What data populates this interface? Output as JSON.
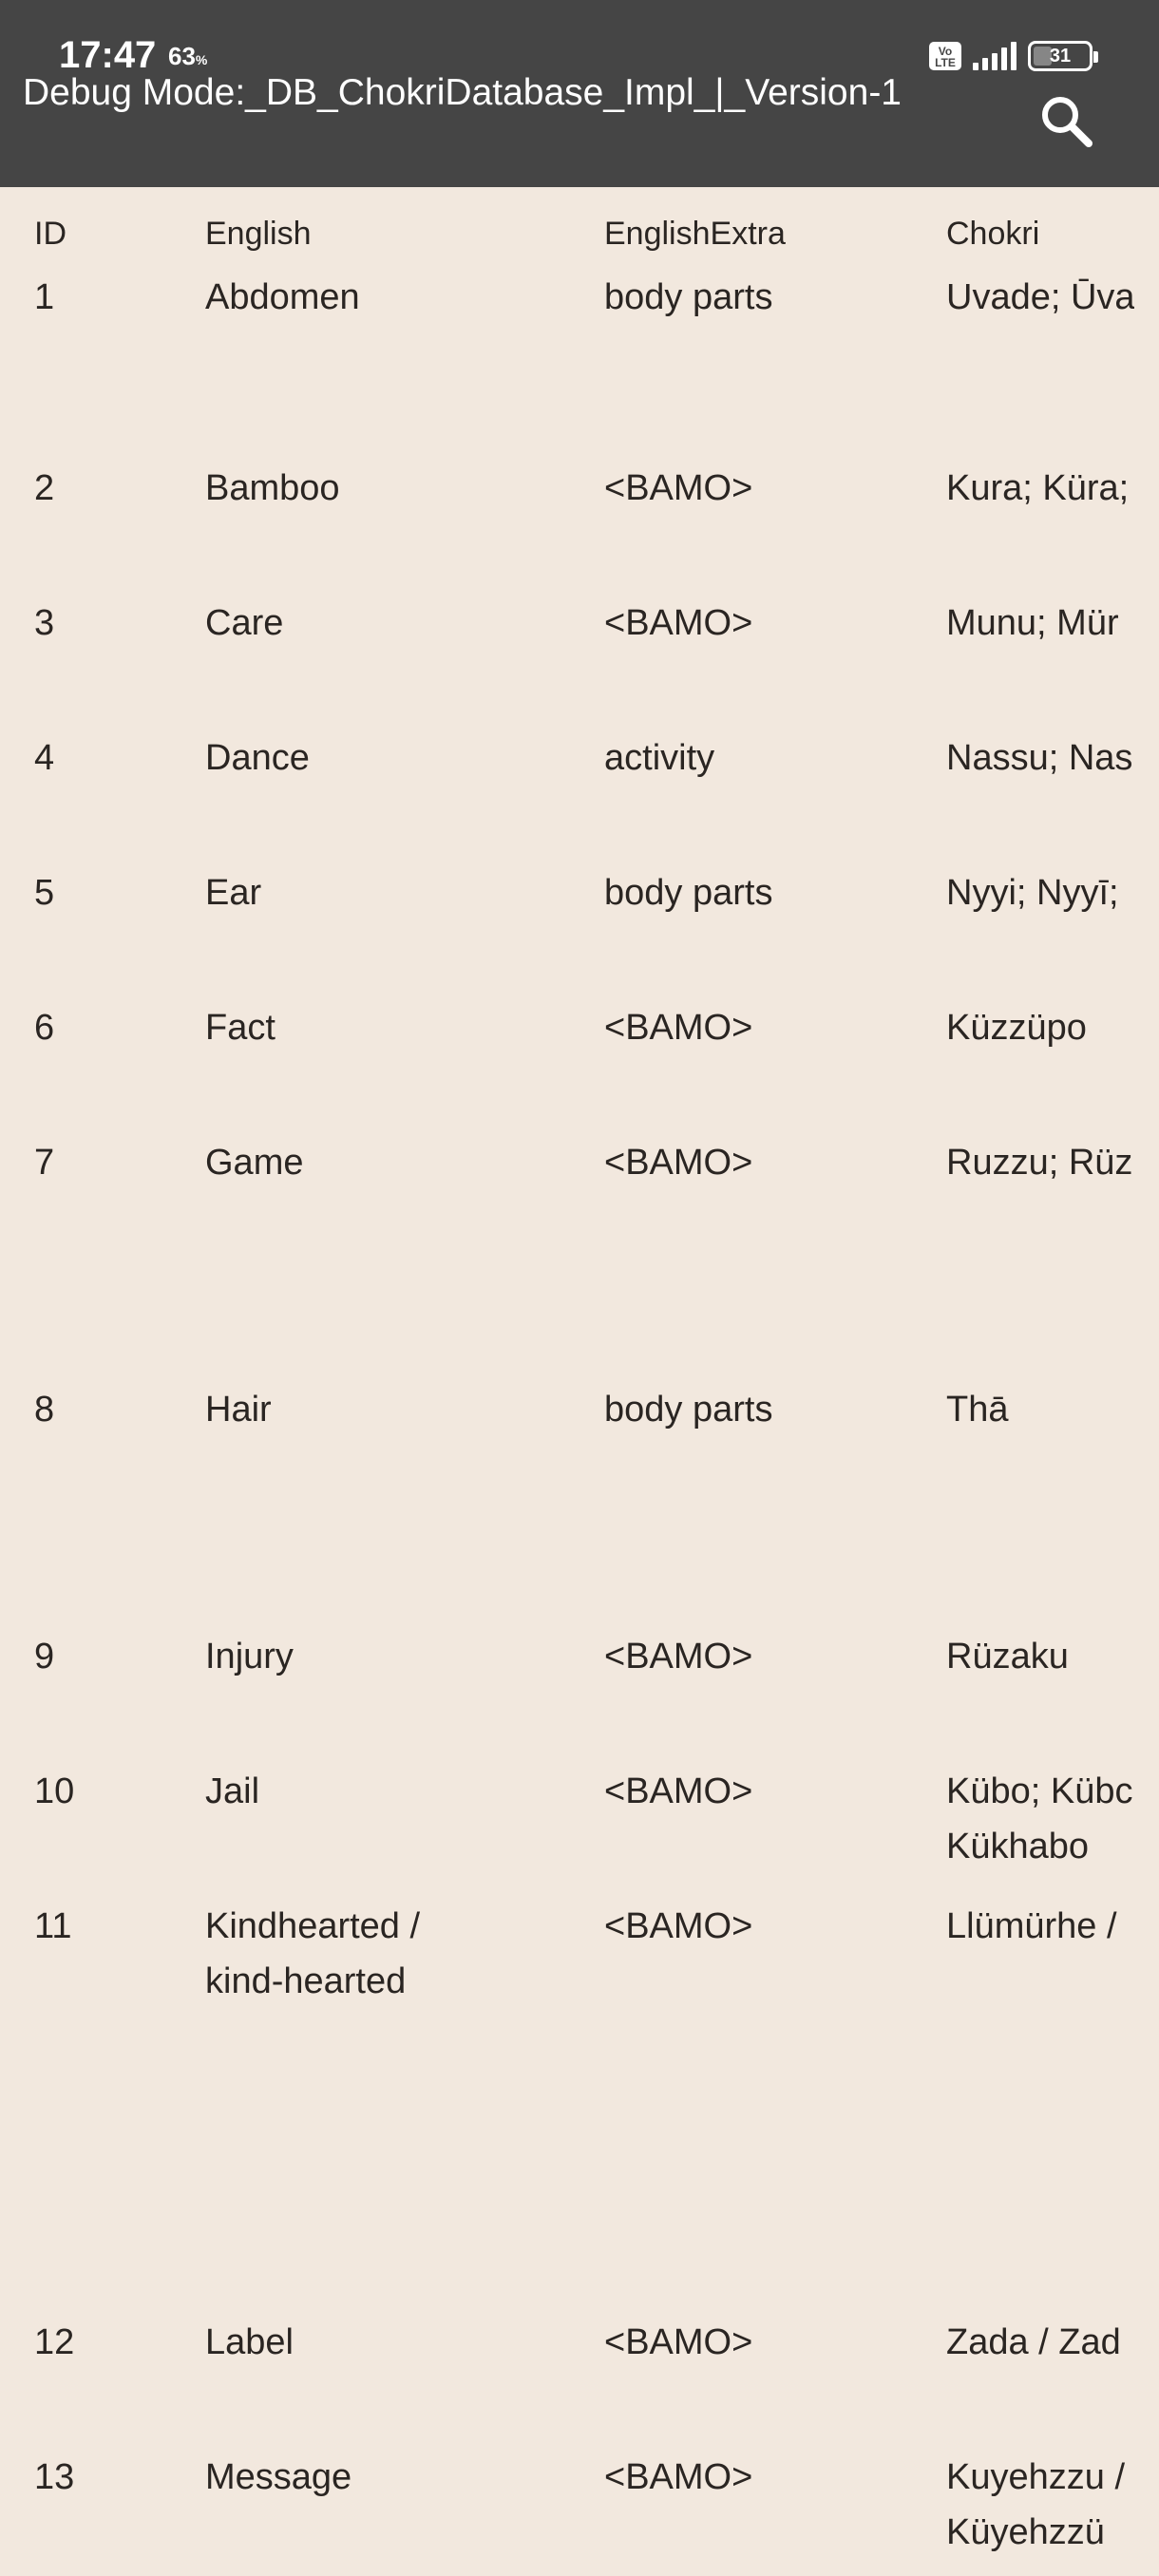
{
  "status_bar": {
    "time": "17:47",
    "battery_saver_pct": "63",
    "volte": "Vo LTE",
    "battery_level": "31"
  },
  "app_bar": {
    "title": "Debug Mode:_DB_ChokriDatabase_Impl_|_Version-1",
    "search_icon": "search-icon"
  },
  "table": {
    "headers": [
      "ID",
      "English",
      "EnglishExtra",
      "Chokri"
    ],
    "rows": [
      {
        "id": "1",
        "english": [
          "Abdomen"
        ],
        "extra": "body parts",
        "chokri": [
          "Uvade; Ūva"
        ]
      },
      {
        "id": "2",
        "english": [
          "Bamboo"
        ],
        "extra": "<BAMO>",
        "chokri": [
          "Kura; Küra;"
        ]
      },
      {
        "id": "3",
        "english": [
          "Care"
        ],
        "extra": "<BAMO>",
        "chokri": [
          "Munu; Mür"
        ]
      },
      {
        "id": "4",
        "english": [
          "Dance"
        ],
        "extra": "activity",
        "chokri": [
          "Nassu; Nas"
        ]
      },
      {
        "id": "5",
        "english": [
          "Ear"
        ],
        "extra": "body parts",
        "chokri": [
          "Nyyi; Nyyī;"
        ]
      },
      {
        "id": "6",
        "english": [
          "Fact"
        ],
        "extra": "<BAMO>",
        "chokri": [
          "Küzzüpo"
        ]
      },
      {
        "id": "7",
        "english": [
          "Game"
        ],
        "extra": "<BAMO>",
        "chokri": [
          "Ruzzu; Rüz"
        ]
      },
      {
        "id": "8",
        "english": [
          "Hair"
        ],
        "extra": "body parts",
        "chokri": [
          "Thā"
        ]
      },
      {
        "id": "9",
        "english": [
          "Injury"
        ],
        "extra": "<BAMO>",
        "chokri": [
          "Rüzaku"
        ]
      },
      {
        "id": "10",
        "english": [
          "Jail"
        ],
        "extra": "<BAMO>",
        "chokri": [
          "Kübo; Kübc",
          "Kükhabo"
        ]
      },
      {
        "id": "11",
        "english": [
          "Kindhearted /",
          "kind-hearted"
        ],
        "extra": "<BAMO>",
        "chokri": [
          "Llümürhe /"
        ]
      },
      {
        "id": "12",
        "english": [
          "Label"
        ],
        "extra": "<BAMO>",
        "chokri": [
          "Zada / Zad"
        ]
      },
      {
        "id": "13",
        "english": [
          "Message"
        ],
        "extra": "<BAMO>",
        "chokri": [
          "Kuyehzzu /",
          "Küyehzzü"
        ]
      }
    ]
  },
  "colors": {
    "app_bar_bg": "#454545",
    "page_bg": "#f2e8de",
    "text": "#2a2522"
  }
}
